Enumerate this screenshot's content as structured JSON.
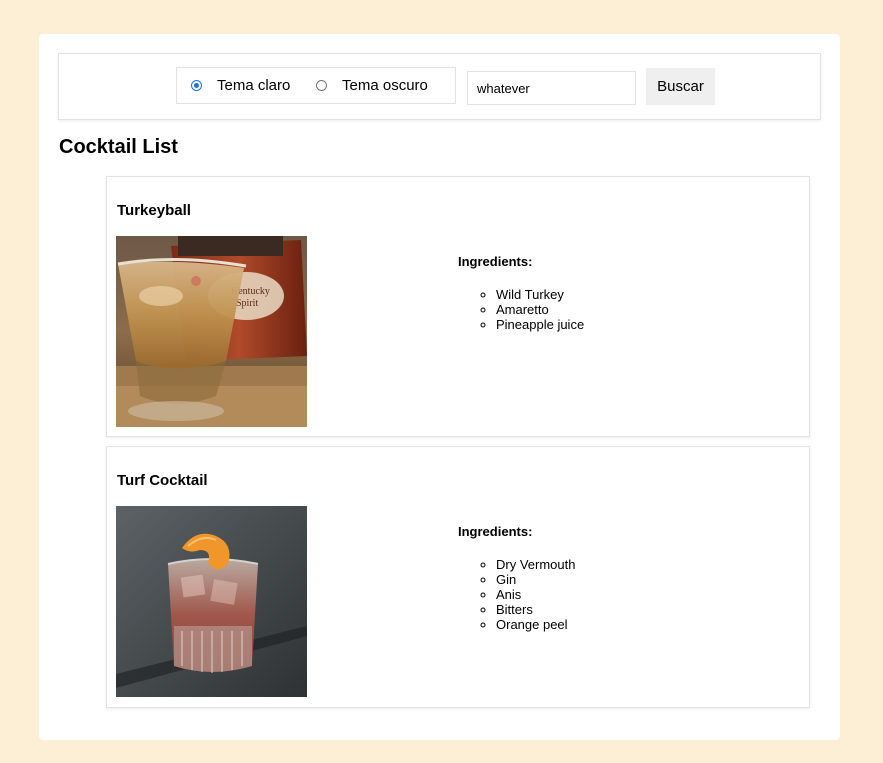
{
  "toolbar": {
    "theme_light_label": "Tema claro",
    "theme_dark_label": "Tema oscuro",
    "selected_theme": "light",
    "search_value": "whatever",
    "search_button_label": "Buscar"
  },
  "list_title": "Cocktail List",
  "cocktails": [
    {
      "name": "Turkeyball",
      "ingredients_label": "Ingredients:",
      "ingredients": [
        "Wild Turkey",
        "Amaretto",
        "Pineapple juice"
      ]
    },
    {
      "name": "Turf Cocktail",
      "ingredients_label": "Ingredients:",
      "ingredients": [
        "Dry Vermouth",
        "Gin",
        "Anis",
        "Bitters",
        "Orange peel"
      ]
    }
  ],
  "colors": {
    "page_background": "#fdefd6",
    "panel_background": "#ffffff",
    "radio_accent": "#1a73e8",
    "button_background": "#efefef"
  }
}
